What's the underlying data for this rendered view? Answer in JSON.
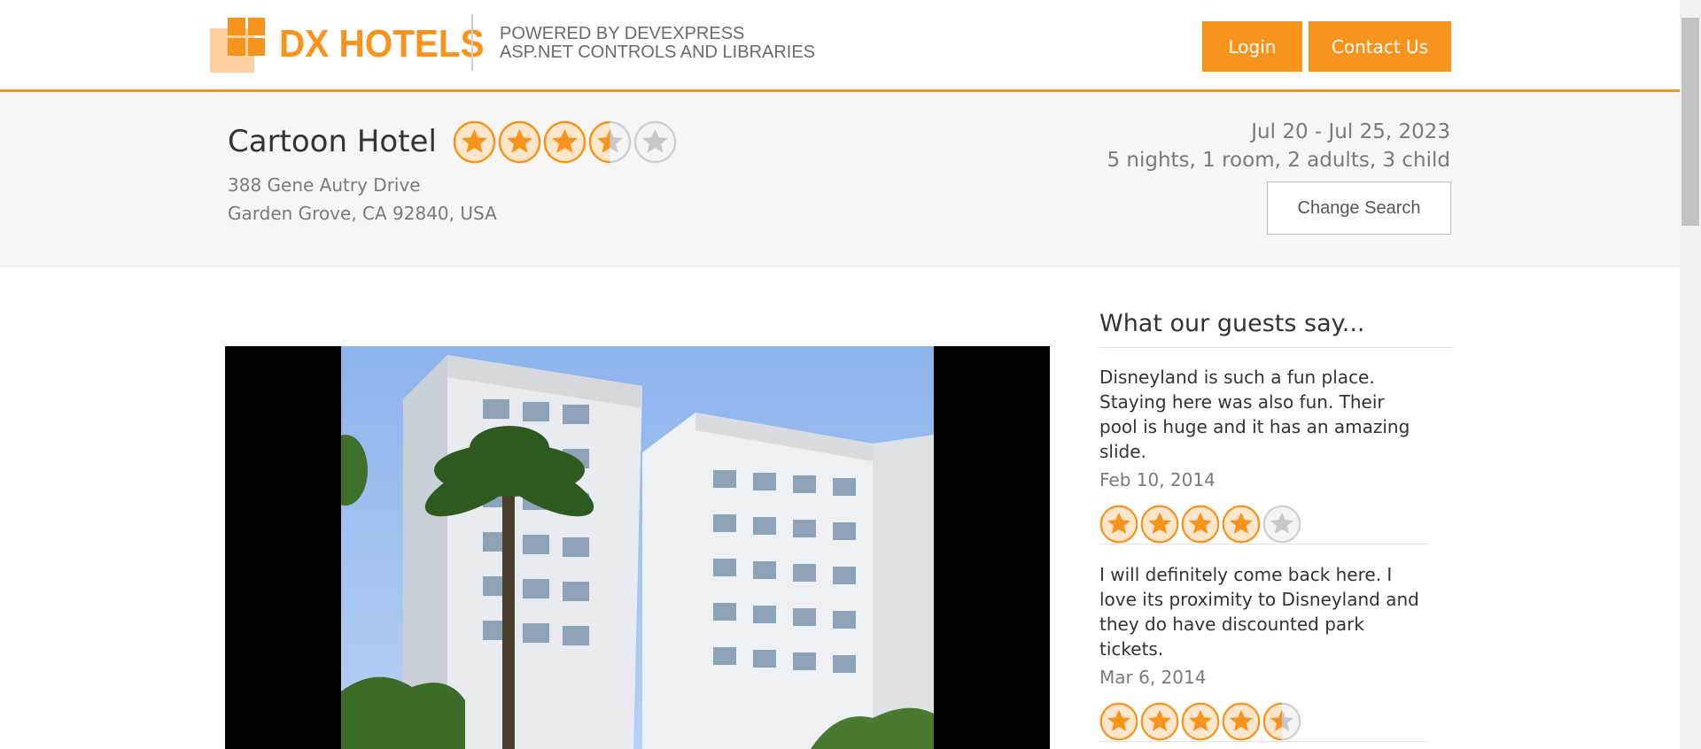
{
  "brand": {
    "name": "DX HOTELS",
    "powered_line1": "POWERED BY DEVEXPRESS",
    "powered_line2": "ASP.NET CONTROLS AND LIBRARIES",
    "accent": "#f7941d"
  },
  "header": {
    "login_label": "Login",
    "contact_label": "Contact Us"
  },
  "hotel": {
    "name": "Cartoon Hotel",
    "rating": 3.5,
    "address_line1": "388 Gene Autry Drive",
    "address_line2": "Garden Grove, CA 92840, USA"
  },
  "search": {
    "dates": "Jul 20 - Jul 25, 2023",
    "summary": "5 nights, 1 room, 2 adults, 3 child",
    "change_label": "Change Search"
  },
  "photo": {
    "icon": "hotel-building-photo"
  },
  "reviews": {
    "title": "What our guests say...",
    "items": [
      {
        "text": "Disneyland is such a fun place. Staying here was also fun. Their pool is huge and it has an amazing slide.",
        "date": "Feb 10, 2014",
        "rating": 4
      },
      {
        "text": "I will definitely come back here. I love its proximity to Disneyland and they do have discounted park tickets.",
        "date": "Mar 6, 2014",
        "rating": 4.5
      }
    ]
  }
}
